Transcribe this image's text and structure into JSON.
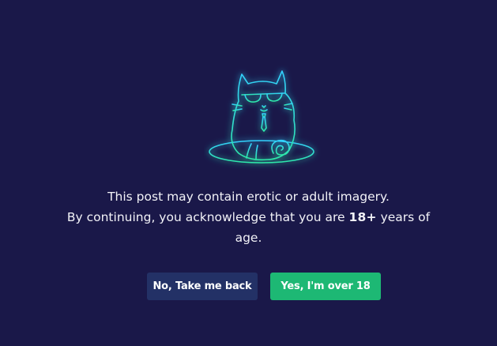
{
  "age_gate": {
    "illustration_icon": "cat-with-sunglasses-icon",
    "message_line1": "This post may contain erotic or adult imagery.",
    "message_line2_prefix": "By continuing, you acknowledge that you are",
    "message_age": "18+",
    "message_line2_suffix": "years of",
    "message_line3": "age.",
    "back_button_label": "No, Take me back",
    "confirm_button_label": "Yes, I'm over 18"
  },
  "colors": {
    "background": "#1a1849",
    "back_button": "#233166",
    "confirm_button": "#1db874",
    "neon_cyan": "#33d1ff",
    "neon_green": "#2ee8a8"
  }
}
